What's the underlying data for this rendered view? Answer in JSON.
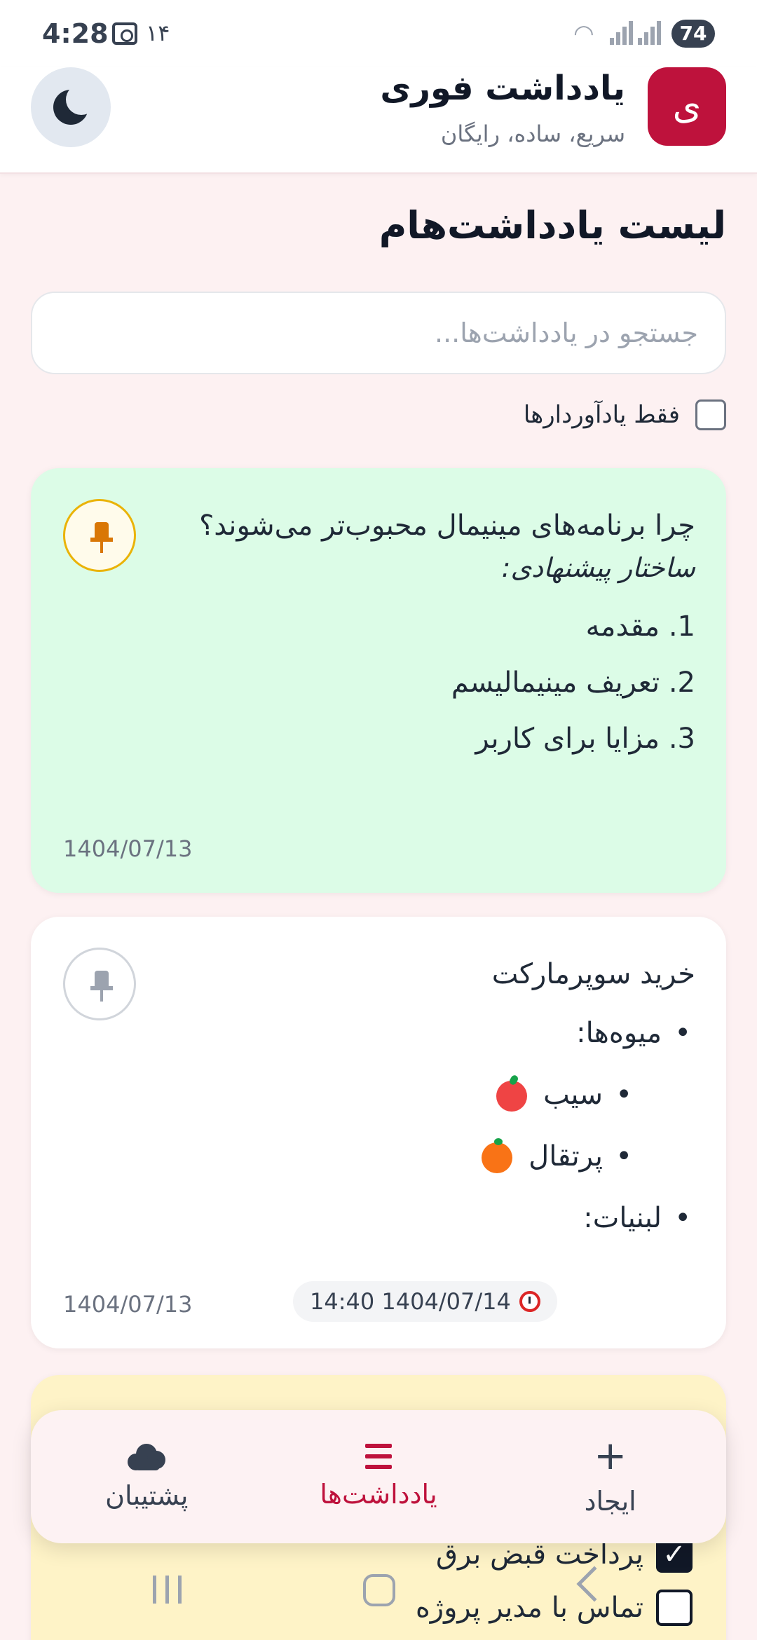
{
  "status_bar": {
    "time": "4:28",
    "notification_count": "۱۴",
    "battery": "74",
    "icons": [
      "screen-record-icon",
      "wifi-icon",
      "signal-icon",
      "signal-icon",
      "battery-icon"
    ]
  },
  "header": {
    "logo_letter": "ی",
    "title": "یادداشت فوری",
    "subtitle": "سریع، ساده، رایگان",
    "theme_icon": "moon-icon",
    "brand_color": "#be123c"
  },
  "main": {
    "page_title": "لیست یادداشت‌هام",
    "search_placeholder": "جستجو در یادداشت‌ها...",
    "reminder_filter_label": "فقط یادآوردارها"
  },
  "notes": [
    {
      "color": "#dcfce7",
      "pinned": true,
      "heading": "چرا برنامه‌های مینیمال محبوب‌تر می‌شوند؟",
      "italic": "ساختار پیشنهادی:",
      "ordered_items": [
        "1. مقدمه",
        "2. تعریف مینیمالیسم",
        "3. مزایا برای کاربر"
      ],
      "date": "1404/07/13"
    },
    {
      "color": "#ffffff",
      "pinned": false,
      "heading": "خرید سوپرمارکت",
      "items": [
        "میوه‌ها:",
        "سیب",
        "پرتقال",
        "لبنیات:"
      ],
      "date": "1404/07/13",
      "reminder": "14:40 1404/07/14"
    },
    {
      "color": "#fef3c7",
      "checklist": [
        {
          "label": "پرداخت قبض برق",
          "checked": true
        },
        {
          "label": "تماس با مدیر پروژه",
          "checked": false
        }
      ]
    }
  ],
  "bottom_nav": {
    "items": [
      {
        "label": "ایجاد",
        "icon": "plus-icon"
      },
      {
        "label": "یادداشت‌ها",
        "icon": "list-icon",
        "active": true
      },
      {
        "label": "پشتیبان",
        "icon": "cloud-icon"
      }
    ]
  }
}
